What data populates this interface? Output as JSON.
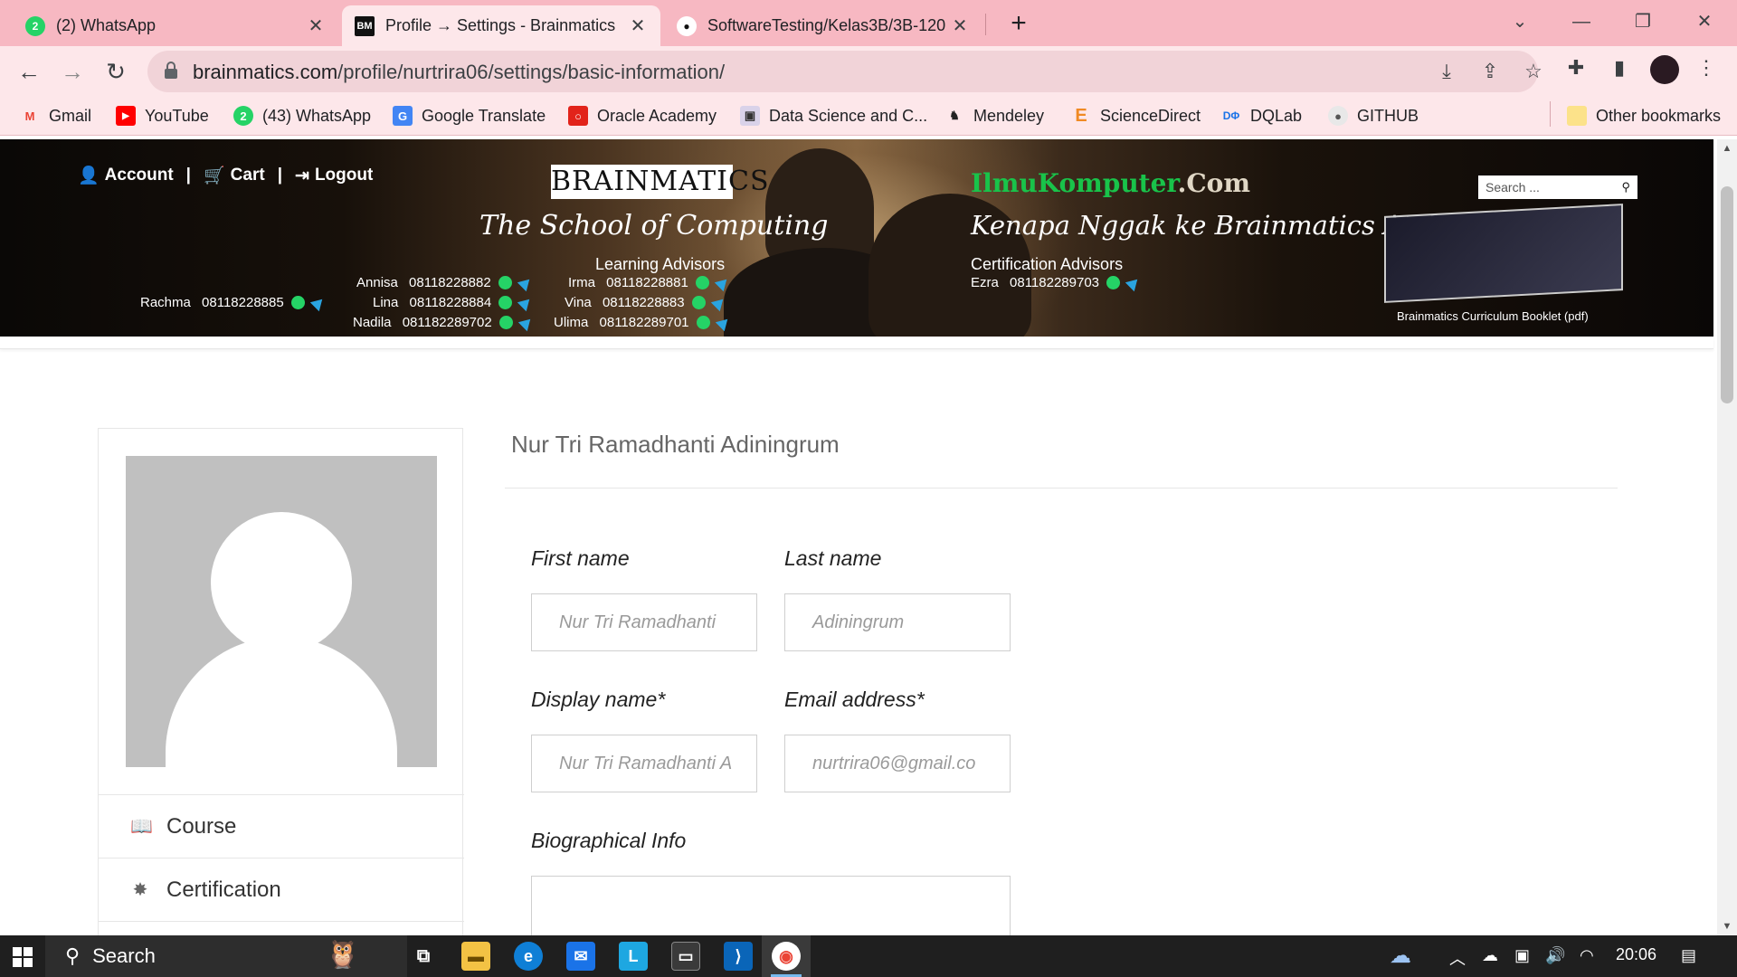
{
  "tabs": [
    {
      "title": "(2) WhatsApp",
      "favicon": "whatsapp-icon",
      "active": false
    },
    {
      "title": "Profile → Settings - Brainmatics",
      "favicon": "brainmatics-icon",
      "active": true
    },
    {
      "title": "SoftwareTesting/Kelas3B/3B-120",
      "favicon": "github-icon",
      "active": false
    }
  ],
  "window": {
    "minimize": "—",
    "restore": "❐",
    "close": "✕",
    "tab_search": "⌄",
    "new_tab": "+"
  },
  "address_bar": {
    "host": "brainmatics.com",
    "path": "/profile/nurtrira06/settings/basic-information/"
  },
  "bookmarks": [
    {
      "label": "Gmail",
      "icon": "gmail-icon"
    },
    {
      "label": "YouTube",
      "icon": "youtube-icon"
    },
    {
      "label": "(43) WhatsApp",
      "icon": "whatsapp-icon"
    },
    {
      "label": "Google Translate",
      "icon": "google-translate-icon"
    },
    {
      "label": "Oracle Academy",
      "icon": "oracle-icon"
    },
    {
      "label": "Data Science and C...",
      "icon": "datascience-icon"
    },
    {
      "label": "Mendeley",
      "icon": "mendeley-icon"
    },
    {
      "label": "ScienceDirect",
      "icon": "elsevier-icon"
    },
    {
      "label": "DQLab",
      "icon": "dqlab-icon"
    },
    {
      "label": "GITHUB",
      "icon": "github-icon"
    }
  ],
  "other_bookmarks": "Other bookmarks",
  "banner": {
    "account": "Account",
    "cart": "Cart",
    "logout": "Logout",
    "logo": "BRAINMATICS",
    "tagline": "The School of Computing",
    "learning_advisors_title": "Learning Advisors",
    "learning_advisors": [
      {
        "name": "Annisa",
        "phone": "08118228882"
      },
      {
        "name": "Lina",
        "phone": "08118228884"
      },
      {
        "name": "Nadila",
        "phone": "081182289702"
      },
      {
        "name": "Irma",
        "phone": "08118228881"
      },
      {
        "name": "Vina",
        "phone": "08118228883"
      },
      {
        "name": "Ulima",
        "phone": "081182289701"
      }
    ],
    "left_contact": {
      "name": "Rachma",
      "phone": "08118228885"
    },
    "site_name": "IlmuKomputer",
    "site_suffix": ".Com",
    "slogan": "Kenapa Nggak ke Brainmatics Aja?",
    "certification_advisors_title": "Certification Advisors",
    "certification_advisor": {
      "name": "Ezra",
      "phone": "081182289703"
    },
    "search_placeholder": "Search ...",
    "booklet_caption": "Brainmatics Curriculum Booklet (pdf)"
  },
  "profile": {
    "display_name": "Nur Tri Ramadhanti Adiningrum",
    "menu": [
      {
        "label": "Course",
        "icon": "book-icon"
      },
      {
        "label": "Certification",
        "icon": "certificate-icon"
      }
    ]
  },
  "form": {
    "first_name_label": "First name",
    "first_name_value": "Nur Tri Ramadhanti",
    "last_name_label": "Last name",
    "last_name_value": "Adiningrum",
    "display_name_label": "Display name*",
    "display_name_value": "Nur Tri Ramadhanti A",
    "email_label": "Email address*",
    "email_value": "nurtrira06@gmail.co",
    "bio_label": "Biographical Info"
  },
  "taskbar": {
    "search_label": "Search",
    "time": "20:06"
  },
  "colors": {
    "tab_strip": "#f7b8c2",
    "toolbar": "#fde7ea",
    "whatsapp_green": "#25d366",
    "site_green": "#19c34a"
  }
}
